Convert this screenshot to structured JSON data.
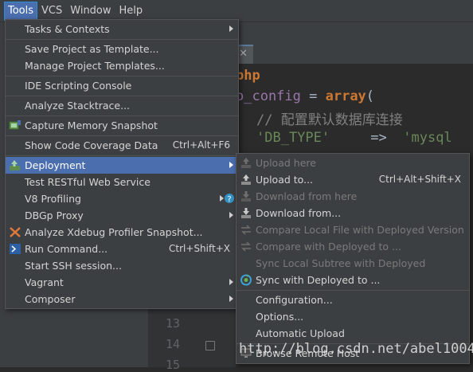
{
  "menubar": {
    "items": [
      {
        "label": "Tools"
      },
      {
        "label": "VCS"
      },
      {
        "label": "Window"
      },
      {
        "label": "Help"
      }
    ]
  },
  "editor": {
    "code": {
      "l1": "php",
      "l2_var": "o_config",
      "l2_op": " = ",
      "l2_kw": "array",
      "l2_paren": "(",
      "l3": "// 配置默认数据库连接",
      "l4_key": "'DB_TYPE'",
      "l4_arrow": "     =>  ",
      "l4_val": "'mysql"
    },
    "line_numbers": [
      "13",
      "14",
      "15"
    ],
    "watermark": "http://blog.csdn.net/abel1004",
    "watermark_tail": "'db_type'   =>  'mysq"
  },
  "tools_menu": {
    "items": {
      "tasks": "Tasks & Contexts",
      "save_template": "Save Project as Template...",
      "manage_templates": "Manage Project Templates...",
      "ide_scripting": "IDE Scripting Console",
      "analyze_stacktrace": "Analyze Stacktrace...",
      "capture_memory": "Capture Memory Snapshot",
      "code_coverage": "Show Code Coverage Data",
      "code_coverage_shortcut": "Ctrl+Alt+F6",
      "deployment": "Deployment",
      "test_restful": "Test RESTful Web Service",
      "v8_profiling": "V8 Profiling",
      "dbgp_proxy": "DBGp Proxy",
      "xdebug": "Analyze Xdebug Profiler Snapshot...",
      "run_command": "Run Command...",
      "run_command_shortcut": "Ctrl+Shift+X",
      "ssh": "Start SSH session...",
      "vagrant": "Vagrant",
      "composer": "Composer"
    }
  },
  "deployment_menu": {
    "items": {
      "upload_here": "Upload here",
      "upload_to": "Upload to...",
      "upload_to_shortcut": "Ctrl+Alt+Shift+X",
      "download_here": "Download from here",
      "download_from": "Download from...",
      "compare_local": "Compare Local File with Deployed Version",
      "compare_with": "Compare with Deployed to ...",
      "sync_subtree": "Sync Local Subtree with Deployed",
      "sync_with": "Sync with Deployed to ...",
      "configuration": "Configuration...",
      "options": "Options...",
      "auto_upload": "Automatic Upload",
      "browse_remote": "Browse Remote Host"
    }
  },
  "colors": {
    "highlight": "#4b6eaf",
    "menu_bg": "#3c3f41",
    "editor_bg": "#2b2b2b"
  }
}
